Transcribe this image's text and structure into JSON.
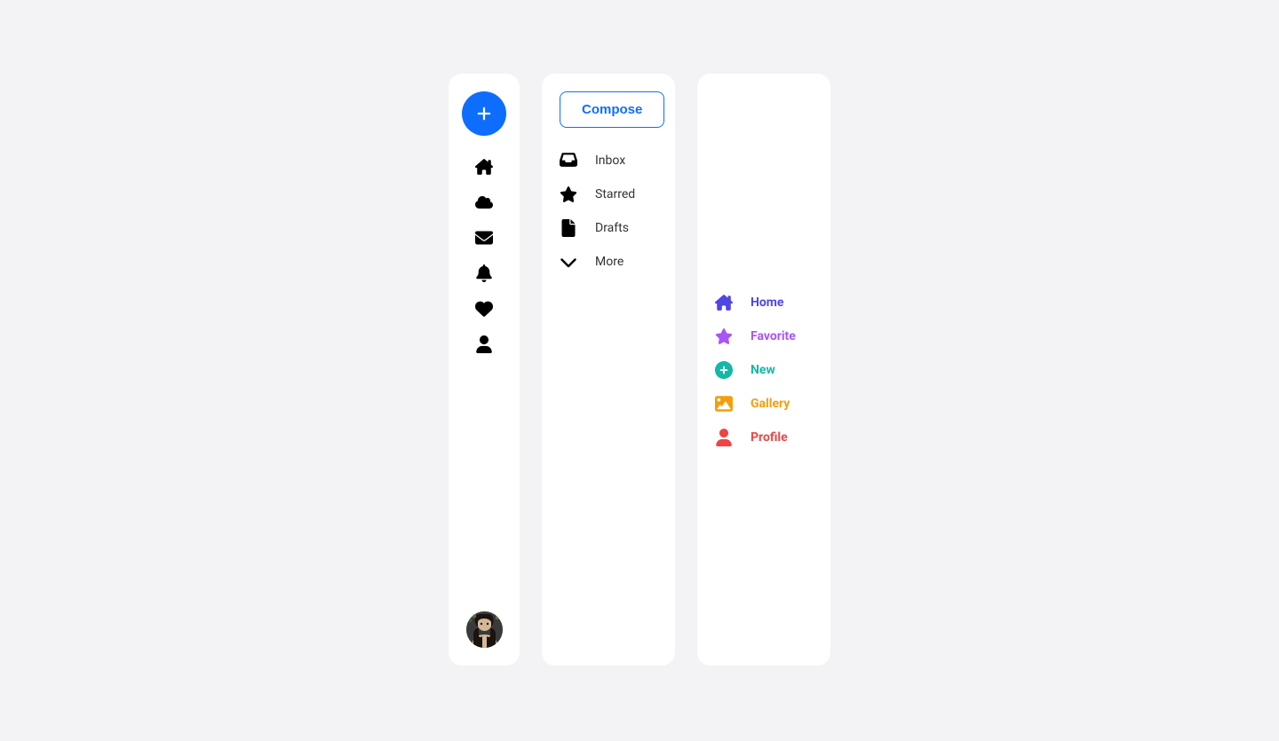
{
  "sidebar1": {
    "icons": [
      {
        "name": "home-icon"
      },
      {
        "name": "cloud-icon"
      },
      {
        "name": "envelope-icon"
      },
      {
        "name": "bell-icon"
      },
      {
        "name": "heart-icon"
      },
      {
        "name": "user-icon"
      }
    ]
  },
  "sidebar2": {
    "compose_label": "Compose",
    "items": [
      {
        "icon": "inbox-icon",
        "label": "Inbox"
      },
      {
        "icon": "star-icon",
        "label": "Starred"
      },
      {
        "icon": "file-icon",
        "label": "Drafts"
      },
      {
        "icon": "chevron-down-icon",
        "label": "More"
      }
    ]
  },
  "sidebar3": {
    "items": [
      {
        "icon": "home-icon",
        "label": "Home",
        "color": "indigo"
      },
      {
        "icon": "star-icon",
        "label": "Favorite",
        "color": "purple"
      },
      {
        "icon": "plus-circle-icon",
        "label": "New",
        "color": "teal"
      },
      {
        "icon": "image-icon",
        "label": "Gallery",
        "color": "orange"
      },
      {
        "icon": "user-icon",
        "label": "Profile",
        "color": "red"
      }
    ]
  }
}
